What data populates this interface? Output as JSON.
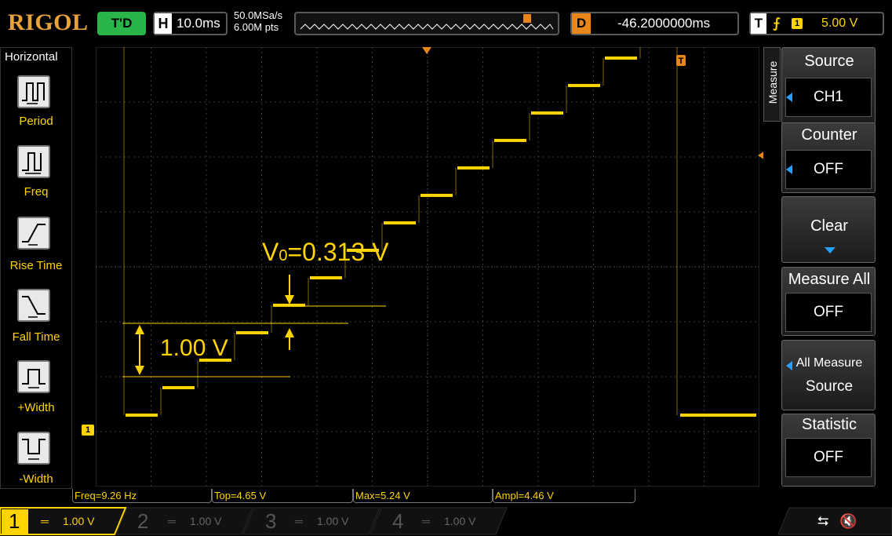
{
  "header": {
    "logo": "RIGOL",
    "mode": "T'D",
    "horizontal_key": "H",
    "timebase": "10.0ms",
    "sample_rate": "50.0MSa/s",
    "memory_depth": "6.00M pts",
    "delay_key": "D",
    "delay": "-46.2000000ms",
    "trigger_key": "T",
    "trigger_source": "1",
    "trigger_level": "5.00 V"
  },
  "left_menu": {
    "title": "Horizontal",
    "items": [
      "Period",
      "Freq",
      "Rise Time",
      "Fall Time",
      "+Width",
      "-Width"
    ]
  },
  "right_menu": {
    "tab": "Measure",
    "source_label": "Source",
    "source_value": "CH1",
    "counter_label": "Counter",
    "counter_value": "OFF",
    "clear_label": "Clear",
    "measure_all_label": "Measure All",
    "measure_all_value": "OFF",
    "all_measure_source_line1": "All Measure",
    "all_measure_source_line2": "Source",
    "statistic_label": "Statistic",
    "statistic_value": "OFF"
  },
  "measurements": {
    "freq": "Freq=9.26 Hz",
    "top": "Top=4.65 V",
    "max": "Max=5.24 V",
    "ampl": "Ampl=4.46 V"
  },
  "annotations": {
    "step": "V0=0.313 V",
    "step_base": "V",
    "step_sub": "0",
    "step_rest": "=0.313 V",
    "span": "1.00 V"
  },
  "channels": [
    {
      "num": "1",
      "scale": "1.00 V",
      "active": true
    },
    {
      "num": "2",
      "scale": "1.00 V",
      "active": false
    },
    {
      "num": "3",
      "scale": "1.00 V",
      "active": false
    },
    {
      "num": "4",
      "scale": "1.00 V",
      "active": false
    }
  ],
  "markers": {
    "ch1": "1",
    "trigger": "T"
  },
  "colors": {
    "ch1": "#ffd400",
    "accent": "#e8861a",
    "menu_arrow": "#27a0ff"
  },
  "chart_data": {
    "type": "line",
    "series": [
      {
        "values": [
          0.313,
          0.625,
          0.938,
          1.25,
          1.563,
          1.875,
          2.188,
          2.5,
          2.813,
          3.125,
          3.438,
          3.75,
          4.063,
          4.375,
          4.688
        ],
        "stroke": "#ffd400"
      }
    ],
    "ylim": [
      -0.5,
      4.5
    ],
    "grid": true
  }
}
